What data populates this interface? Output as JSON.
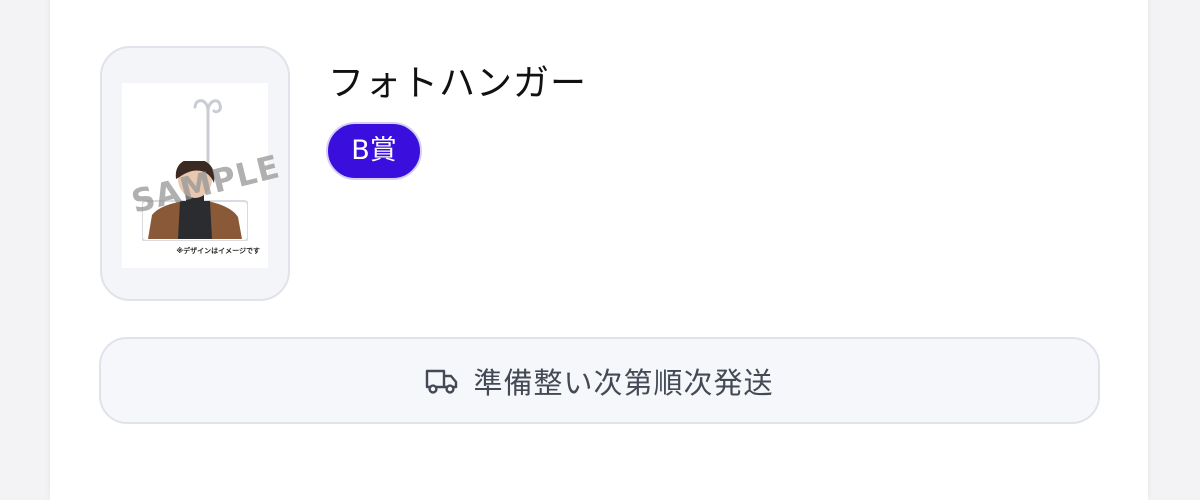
{
  "product": {
    "title": "フォトハンガー",
    "prize_badge": "B賞",
    "thumbnail": {
      "watermark": "SAMPLE",
      "note": "※デザインはイメージです"
    }
  },
  "shipping": {
    "icon": "truck-icon",
    "label": "準備整い次第順次発送"
  },
  "colors": {
    "badge": "#3a0fdd",
    "shipping_text": "#444a55",
    "card_border": "#e2e3ea"
  }
}
